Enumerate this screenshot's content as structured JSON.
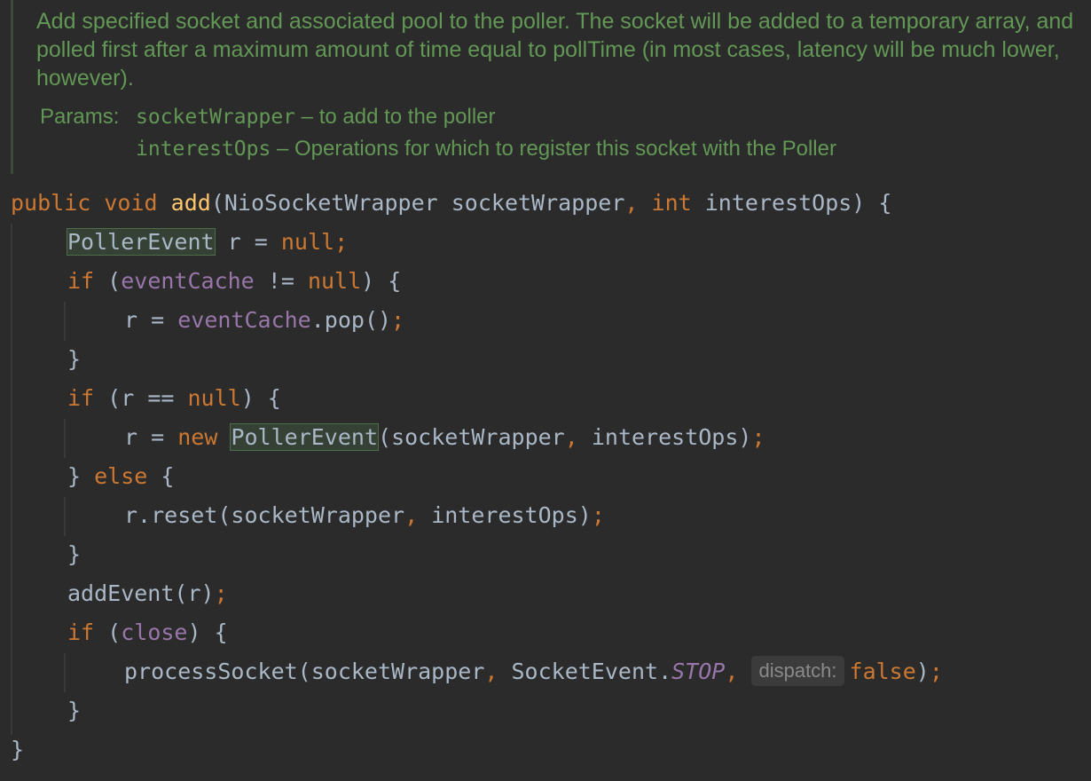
{
  "javadoc": {
    "description": "Add specified socket and associated pool to the poller. The socket will be added to a temporary array, and polled first after a maximum amount of time equal to pollTime (in most cases, latency will be much lower, however).",
    "params_label": "Params:",
    "params": [
      {
        "name": "socketWrapper",
        "text": " – to add to the poller"
      },
      {
        "name": "interestOps",
        "text": " – Operations for which to register this socket with the Poller"
      }
    ]
  },
  "code": {
    "l1": {
      "public": "public",
      "void": "void",
      "method": "add",
      "open": "(NioSocketWrapper socketWrapper",
      "comma": ",",
      "int": "int",
      "rest": " interestOps) {"
    },
    "l2": {
      "type": "PollerEvent",
      "mid": " r = ",
      "null": "null",
      "semi": ";"
    },
    "l3": {
      "if": "if",
      "open": " (",
      "field": "eventCache",
      "op": " != ",
      "null": "null",
      "close": ") {"
    },
    "l4": {
      "pre": "r = ",
      "field": "eventCache",
      "call": ".pop()",
      "semi": ";"
    },
    "l5": {
      "brace": "}"
    },
    "l6": {
      "if": "if",
      "cond": " (r == ",
      "null": "null",
      "close": ") {"
    },
    "l7": {
      "pre": "r = ",
      "new": "new",
      "sp": " ",
      "type": "PollerEvent",
      "args1": "(socketWrapper",
      "comma": ",",
      "args2": " interestOps)",
      "semi": ";"
    },
    "l8": {
      "brace": "} ",
      "else": "else",
      "open": " {"
    },
    "l9": {
      "pre": "r.reset(socketWrapper",
      "comma": ",",
      "post": " interestOps)",
      "semi": ";"
    },
    "l10": {
      "brace": "}"
    },
    "l11": {
      "call": "addEvent(r)",
      "semi": ";"
    },
    "l12": {
      "if": "if",
      "open": " (",
      "field": "close",
      "close": ") {"
    },
    "l13": {
      "pre": "processSocket(socketWrapper",
      "comma1": ",",
      "mid": " SocketEvent.",
      "static": "STOP",
      "comma2": ",",
      "hint": "dispatch:",
      "false": "false",
      "close": ")",
      "semi": ";"
    },
    "l14": {
      "brace": "}"
    },
    "l15": {
      "brace": "}"
    }
  },
  "colors": {
    "background": "#2b2b2b",
    "keyword": "#cc7832",
    "method_declaration": "#ffc66d",
    "field": "#9876aa",
    "plain": "#a9b7c6",
    "doc_comment": "#629755"
  }
}
